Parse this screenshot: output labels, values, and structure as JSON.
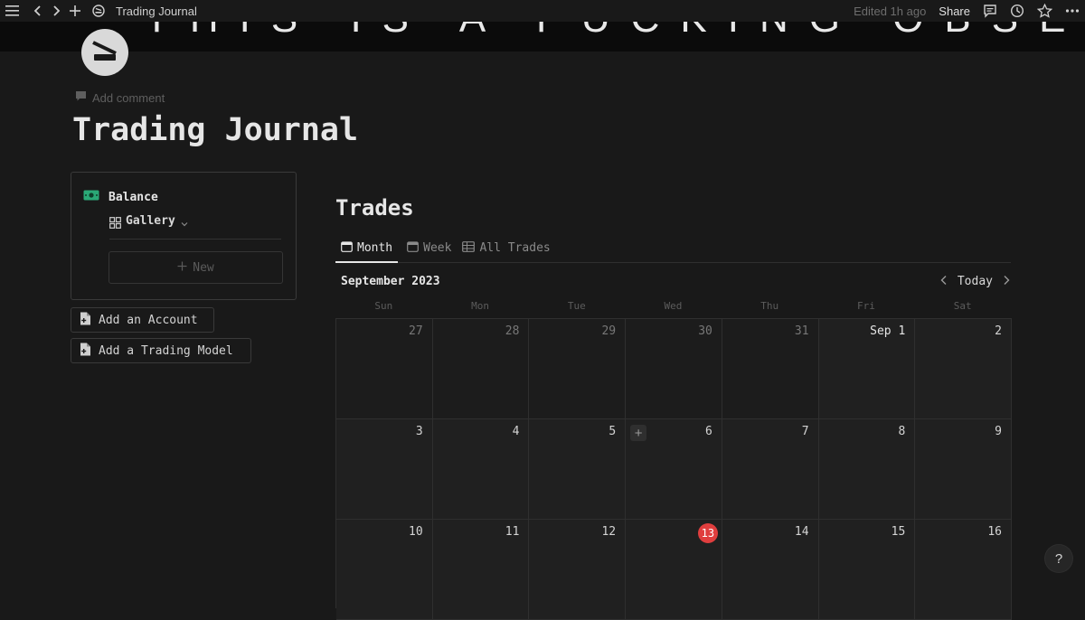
{
  "topbar": {
    "title": "Trading Journal",
    "edited": "Edited 1h ago",
    "share_label": "Share"
  },
  "banner": {
    "text": "THIS IS A FUCKING OBSESSION!"
  },
  "page": {
    "add_comment": "Add comment",
    "title": "Trading Journal"
  },
  "balance": {
    "label": "Balance",
    "view_label": "Gallery",
    "new_label": "New"
  },
  "actions": {
    "add_account": "Add an Account",
    "add_model": "Add a Trading Model"
  },
  "trades": {
    "title": "Trades",
    "tabs": [
      {
        "label": "Month",
        "active": true
      },
      {
        "label": "Week",
        "active": false
      },
      {
        "label": "All Trades",
        "active": false
      }
    ],
    "month_label": "September 2023",
    "today_label": "Today",
    "weekdays": [
      "Sun",
      "Mon",
      "Tue",
      "Wed",
      "Thu",
      "Fri",
      "Sat"
    ],
    "days": [
      {
        "label": "27",
        "out": true
      },
      {
        "label": "28",
        "out": true
      },
      {
        "label": "29",
        "out": true
      },
      {
        "label": "30",
        "out": true
      },
      {
        "label": "31",
        "out": true
      },
      {
        "label": "Sep 1",
        "out": false,
        "first": true
      },
      {
        "label": "2",
        "out": false
      },
      {
        "label": "3"
      },
      {
        "label": "4"
      },
      {
        "label": "5"
      },
      {
        "label": "6",
        "hover_add": true
      },
      {
        "label": "7"
      },
      {
        "label": "8"
      },
      {
        "label": "9"
      },
      {
        "label": "10"
      },
      {
        "label": "11"
      },
      {
        "label": "12"
      },
      {
        "label": "13",
        "today": true
      },
      {
        "label": "14"
      },
      {
        "label": "15"
      },
      {
        "label": "16"
      }
    ]
  },
  "help_label": "?",
  "colors": {
    "background": "#191919",
    "today_badge": "#e03e3e",
    "balance_icon": "#2aa876"
  }
}
